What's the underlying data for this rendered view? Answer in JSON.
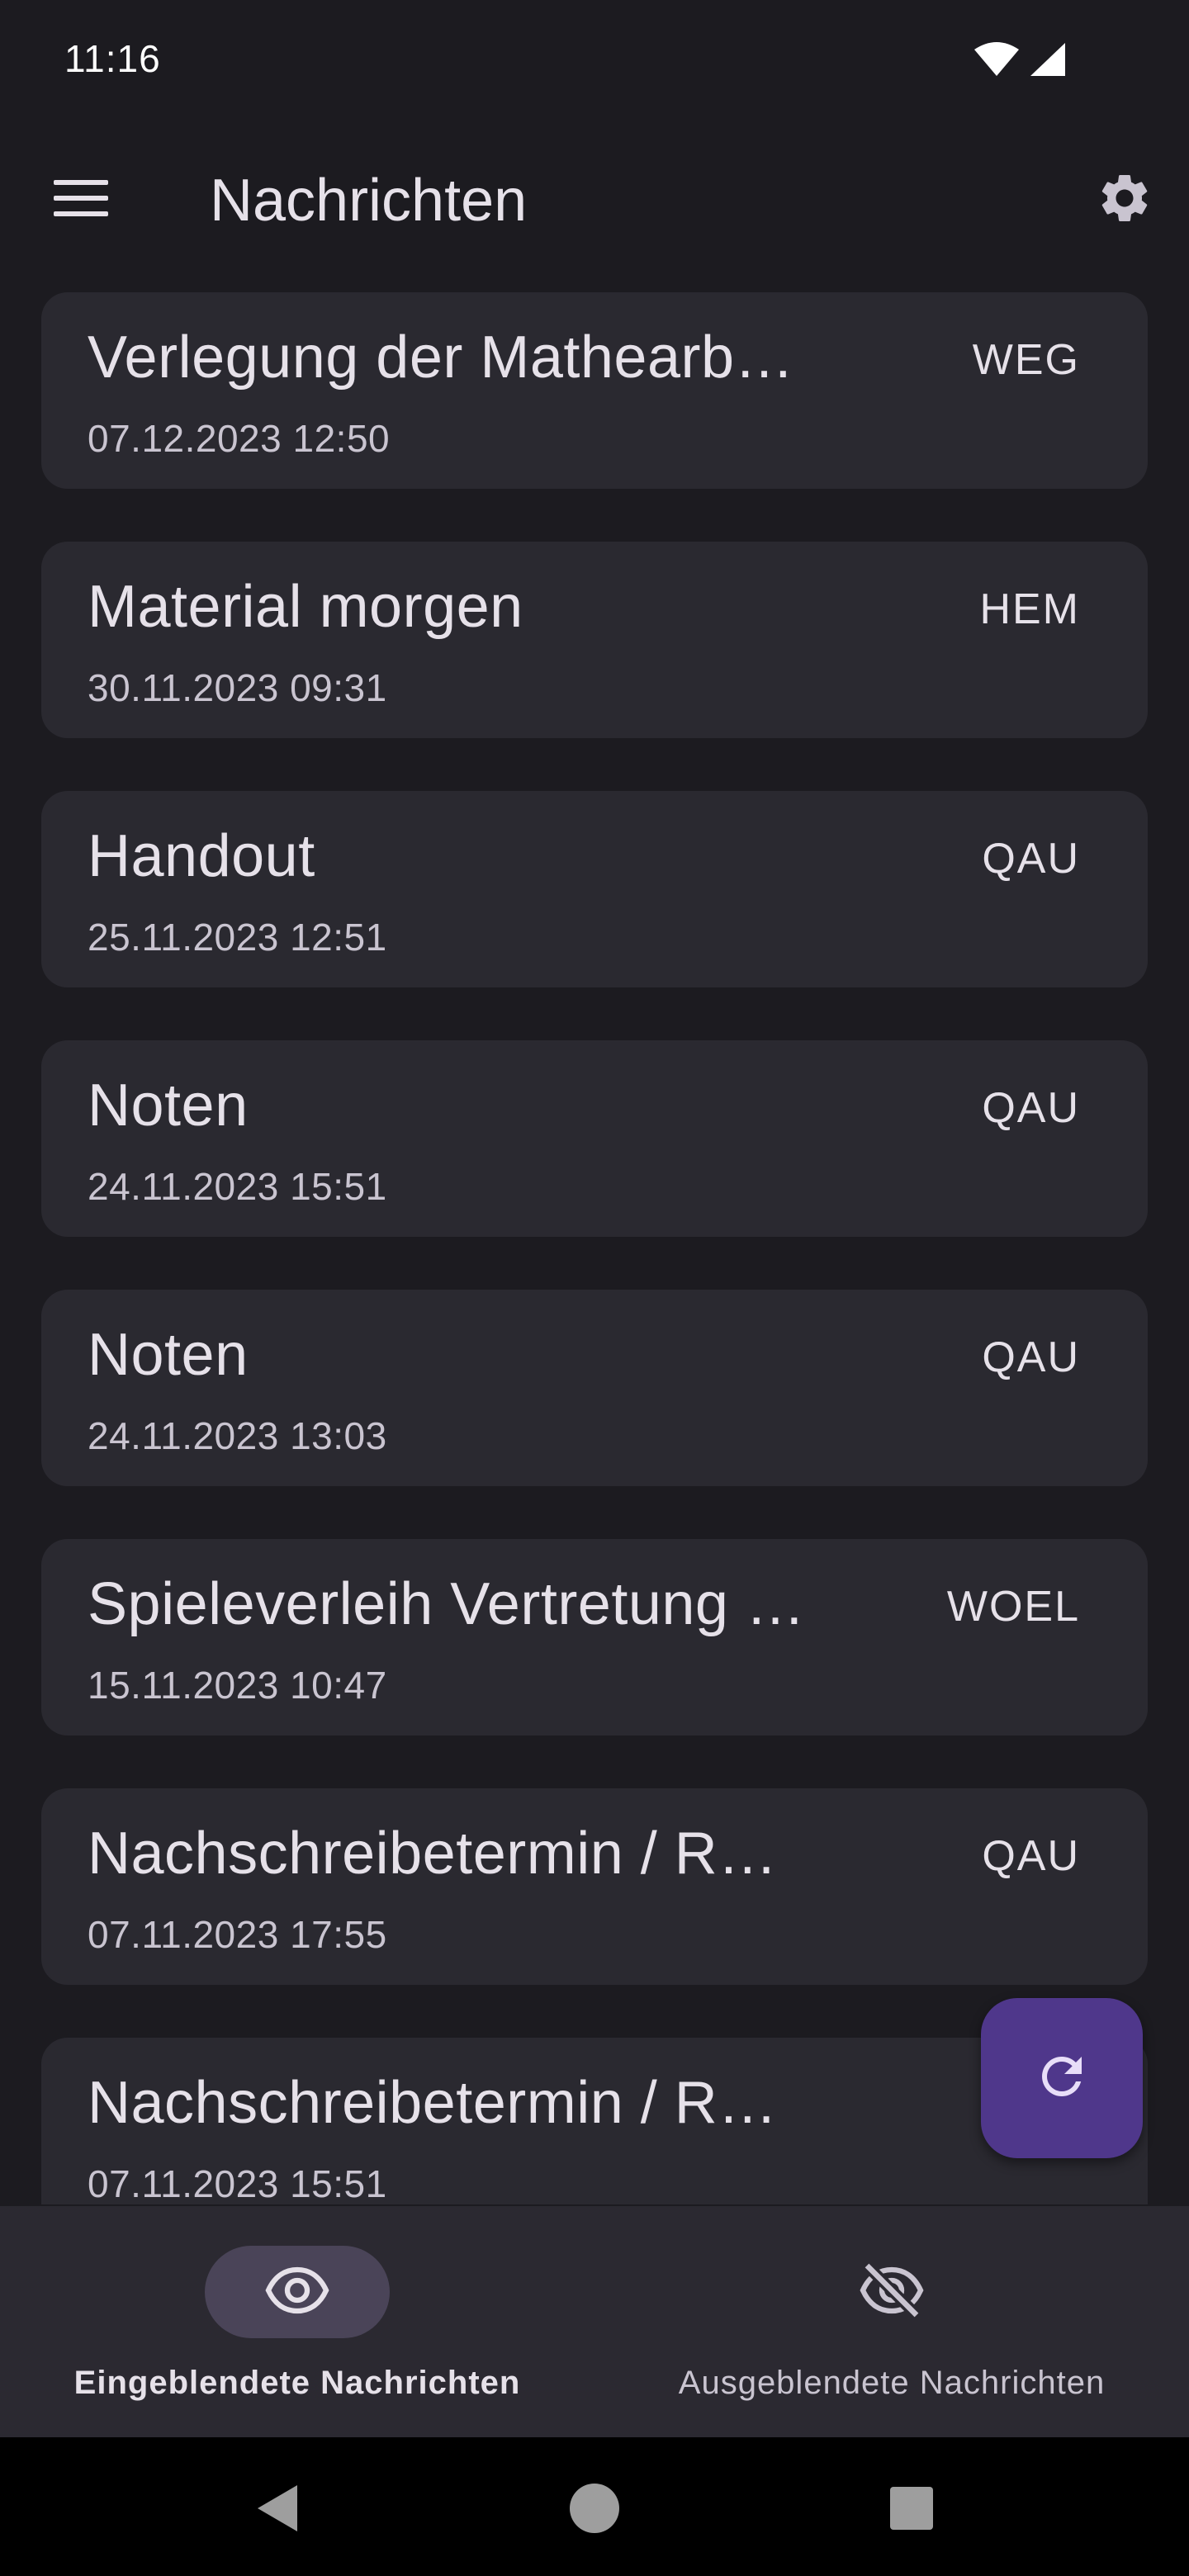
{
  "status_bar": {
    "time": "11:16",
    "icons": [
      "wifi-icon",
      "cellular-signal-icon"
    ]
  },
  "app_bar": {
    "title": "Nachrichten",
    "menu_icon": "hamburger-menu-icon",
    "settings_icon": "gear-icon"
  },
  "messages": [
    {
      "title": "Verlegung der Mathearb…",
      "date": "07.12.2023 12:50",
      "sender": "WEG"
    },
    {
      "title": "Material morgen",
      "date": "30.11.2023 09:31",
      "sender": "HEM"
    },
    {
      "title": "Handout",
      "date": "25.11.2023 12:51",
      "sender": "QAU"
    },
    {
      "title": "Noten",
      "date": "24.11.2023 15:51",
      "sender": "QAU"
    },
    {
      "title": "Noten",
      "date": "24.11.2023 13:03",
      "sender": "QAU"
    },
    {
      "title": "Spieleverleih Vertretung …",
      "date": "15.11.2023 10:47",
      "sender": "WOEL"
    },
    {
      "title": "Nachschreibetermin / R…",
      "date": "07.11.2023 17:55",
      "sender": "QAU"
    },
    {
      "title": "Nachschreibetermin / R…",
      "date": "07.11.2023 15:51",
      "sender": ""
    }
  ],
  "fab": {
    "icon": "refresh-icon"
  },
  "bottom_nav": {
    "items": [
      {
        "label": "Eingeblendete Nachrichten",
        "icon": "eye-icon",
        "selected": true
      },
      {
        "label": "Ausgeblendete Nachrichten",
        "icon": "eye-off-icon",
        "selected": false
      }
    ]
  },
  "system_nav": {
    "icons": [
      "back-icon",
      "home-icon",
      "recents-icon"
    ]
  },
  "colors": {
    "background": "#1c1b20",
    "card": "#2a2930",
    "fab": "#4f378b",
    "nav_background": "#2b2931",
    "nav_pill": "#4a4458"
  }
}
